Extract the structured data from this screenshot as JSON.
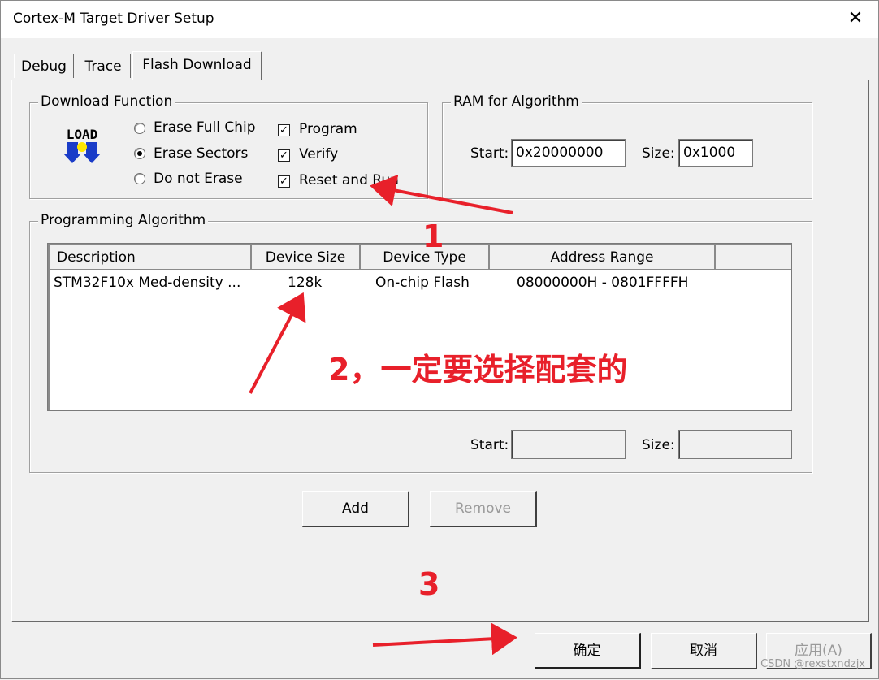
{
  "window": {
    "title": "Cortex-M Target Driver Setup"
  },
  "tabs": [
    {
      "label": "Debug"
    },
    {
      "label": "Trace"
    },
    {
      "label": "Flash Download"
    }
  ],
  "download_function": {
    "legend": "Download Function",
    "logo_text": "LOAD",
    "radios": [
      {
        "label": "Erase Full Chip",
        "selected": false
      },
      {
        "label": "Erase Sectors",
        "selected": true
      },
      {
        "label": "Do not Erase",
        "selected": false
      }
    ],
    "checks": [
      {
        "label": "Program",
        "checked": true
      },
      {
        "label": "Verify",
        "checked": true
      },
      {
        "label": "Reset and Run",
        "checked": true
      }
    ]
  },
  "ram": {
    "legend": "RAM for Algorithm",
    "start_label": "Start:",
    "start_value": "0x20000000",
    "size_label": "Size:",
    "size_value": "0x1000"
  },
  "programming": {
    "legend": "Programming Algorithm",
    "columns": [
      "Description",
      "Device Size",
      "Device Type",
      "Address Range"
    ],
    "rows": [
      [
        "STM32F10x Med-density ...",
        "128k",
        "On-chip Flash",
        "08000000H - 0801FFFFH"
      ]
    ],
    "start_label": "Start:",
    "size_label": "Size:",
    "start_value": "",
    "size_value": ""
  },
  "buttons": {
    "add": "Add",
    "remove": "Remove",
    "ok": "确定",
    "cancel": "取消",
    "apply": "应用(A)"
  },
  "annotations": {
    "one": "1",
    "two": "2，一定要选择配套的",
    "three": "3",
    "color": "#e8202a"
  },
  "watermark": "CSDN @rexstxndzjx",
  "colors": {
    "window_bg": "#f0f0f0",
    "annotation": "#e8202a"
  }
}
